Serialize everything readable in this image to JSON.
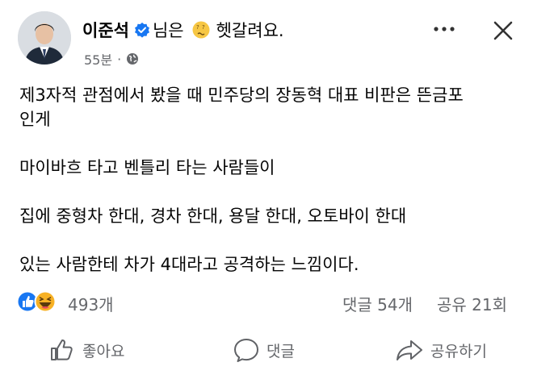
{
  "post": {
    "author": "이준석",
    "feeling_prefix": "님은",
    "feeling_text": "헷갈려요.",
    "timestamp": "55분",
    "meta_separator": "·",
    "privacy_icon": "globe-icon",
    "verified_icon": "verified-badge-icon",
    "feeling_icon": "confused-face-icon",
    "body_lines": [
      "제3자적 관점에서 봤을 때 민주당의 장동혁 대표 비판은 뜬금포",
      "인게",
      "",
      "마이바흐 타고 벤틀리 타는 사람들이",
      "",
      "집에 중형차 한대, 경차 한대, 용달 한대, 오토바이 한대",
      "",
      "있는 사람한테 차가 4대라고 공격하는 느낌이다."
    ]
  },
  "stats": {
    "reactions_count": "493개",
    "comments": "댓글 54개",
    "shares": "공유 21회",
    "reaction_icons": [
      "like-reaction-icon",
      "haha-reaction-icon"
    ]
  },
  "actions": {
    "like": "좋아요",
    "comment": "댓글",
    "share": "공유하기"
  },
  "colors": {
    "text": "#050505",
    "secondary": "#65676b",
    "verified_blue": "#1877f2",
    "like_blue": "#1877f2",
    "haha_yellow": "#f7b125"
  }
}
